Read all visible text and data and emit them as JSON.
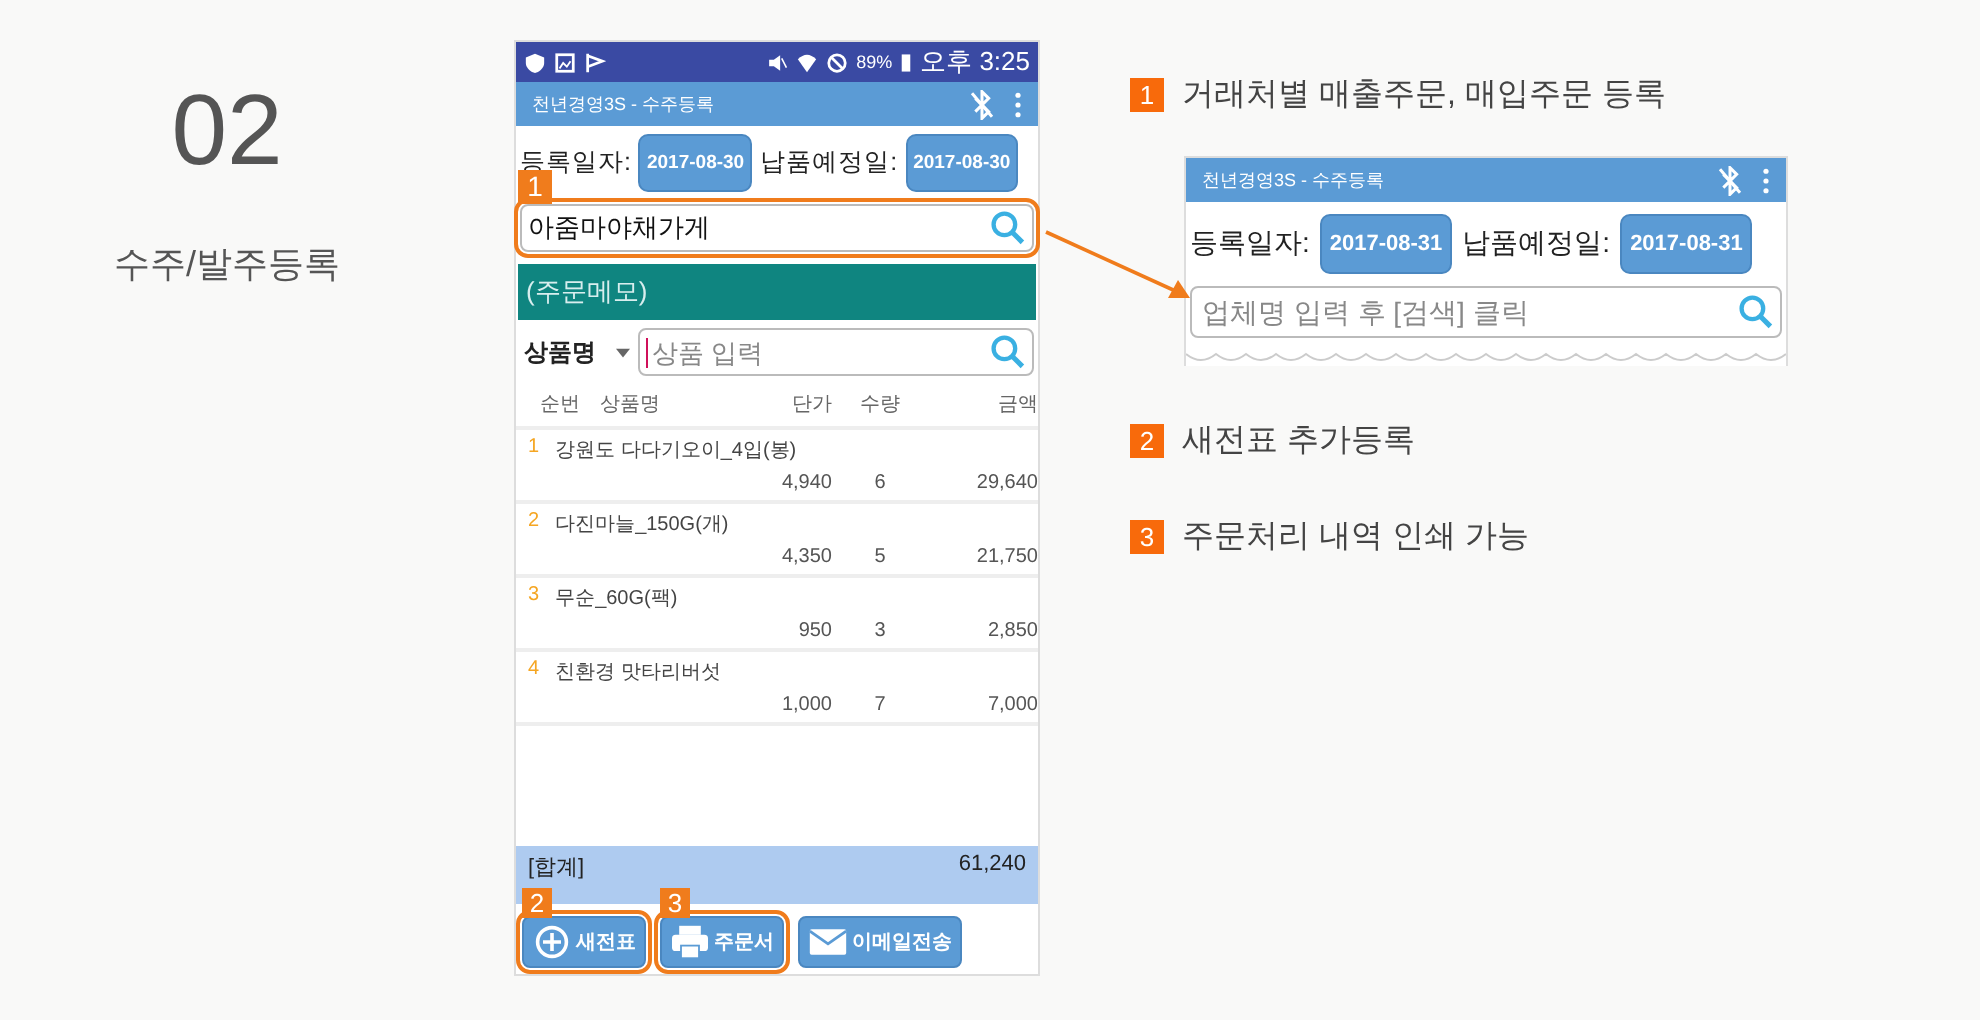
{
  "left": {
    "step": "02",
    "title": "수주/발주등록"
  },
  "phone": {
    "status_bar": {
      "battery": "89%",
      "time": "오후 3:25"
    },
    "app_title": "천년경영3S - 수주등록",
    "register_date_label": "등록일자:",
    "register_date": "2017-08-30",
    "delivery_date_label": "납품예정일:",
    "delivery_date": "2017-08-30",
    "customer_field": {
      "value": "아줌마야채가게",
      "badge": "1"
    },
    "memo": "(주문메모)",
    "product_filter": "상품명",
    "product_field": {
      "placeholder": "상품 입력"
    },
    "table": {
      "columns": [
        "순번",
        "상품명",
        "단가",
        "수량",
        "금액"
      ],
      "rows": [
        {
          "no": "1",
          "name": "강원도 다다기오이_4입(봉)",
          "price": "4,940",
          "qty": "6",
          "amount": "29,640"
        },
        {
          "no": "2",
          "name": "다진마늘_150G(개)",
          "price": "4,350",
          "qty": "5",
          "amount": "21,750"
        },
        {
          "no": "3",
          "name": "무순_60G(팩)",
          "price": "950",
          "qty": "3",
          "amount": "2,850"
        },
        {
          "no": "4",
          "name": "친환경 맛타리버섯",
          "price": "1,000",
          "qty": "7",
          "amount": "7,000"
        }
      ]
    },
    "total": {
      "label": "[합계]",
      "value": "61,240"
    },
    "buttons": [
      {
        "kind": "new",
        "label": "새전표",
        "badge": "2"
      },
      {
        "kind": "print",
        "label": "주문서",
        "badge": "3"
      },
      {
        "kind": "email",
        "label": "이메일전송"
      }
    ]
  },
  "callouts": [
    {
      "number": "1",
      "text": "거래처별 매출주문, 매입주문 등록"
    },
    {
      "number": "2",
      "text": "새전표 추가등록"
    },
    {
      "number": "3",
      "text": "주문처리 내역 인쇄 가능"
    }
  ],
  "inset": {
    "app_title": "천년경영3S - 수주등록",
    "register_date_label": "등록일자:",
    "register_date": "2017-08-31",
    "delivery_date_label": "납품예정일:",
    "delivery_date": "2017-08-31",
    "customer_field": {
      "placeholder": "업체명 입력 후 [검색] 클릭"
    }
  }
}
